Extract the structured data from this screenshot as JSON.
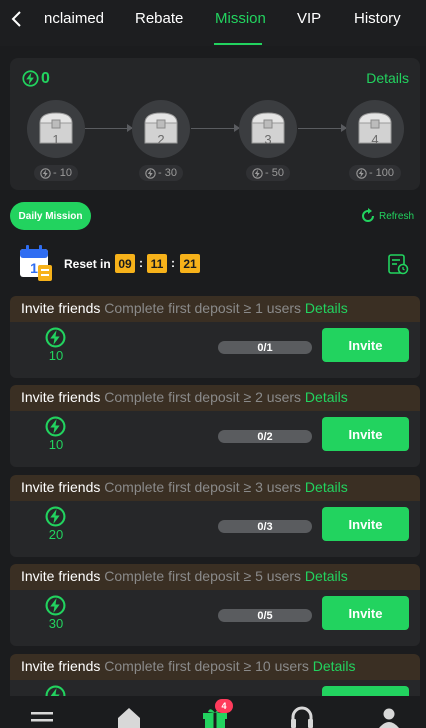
{
  "tabs": {
    "items": [
      {
        "label": "nclaimed"
      },
      {
        "label": "Rebate"
      },
      {
        "label": "Mission"
      },
      {
        "label": "VIP"
      },
      {
        "label": "History"
      }
    ],
    "active": "Mission"
  },
  "progress": {
    "count": "0",
    "details_label": "Details",
    "chests": [
      {
        "number": "1",
        "requirement": "- 10"
      },
      {
        "number": "2",
        "requirement": "- 30"
      },
      {
        "number": "3",
        "requirement": "- 50"
      },
      {
        "number": "4",
        "requirement": "- 100"
      }
    ]
  },
  "daily": {
    "label": "Daily Mission",
    "refresh_label": "Refresh",
    "reset_label": "Reset in",
    "time": {
      "h": "09",
      "m": "11",
      "s": "21"
    }
  },
  "missions": [
    {
      "title": "Invite friends",
      "condition": "Complete first deposit ≥ 1 users",
      "details": "Details",
      "reward": "10",
      "progress": "0/1",
      "button": "Invite"
    },
    {
      "title": "Invite friends",
      "condition": "Complete first deposit ≥ 2 users",
      "details": "Details",
      "reward": "10",
      "progress": "0/2",
      "button": "Invite"
    },
    {
      "title": "Invite friends",
      "condition": "Complete first deposit ≥ 3 users",
      "details": "Details",
      "reward": "20",
      "progress": "0/3",
      "button": "Invite"
    },
    {
      "title": "Invite friends",
      "condition": "Complete first deposit ≥ 5 users",
      "details": "Details",
      "reward": "30",
      "progress": "0/5",
      "button": "Invite"
    },
    {
      "title": "Invite friends",
      "condition": "Complete first deposit ≥ 10 users",
      "details": "Details",
      "reward": "",
      "progress": "",
      "button": ""
    }
  ],
  "nav": {
    "gift_badge": "4",
    "icons": [
      "menu-icon",
      "home-icon",
      "gift-icon",
      "headset-icon",
      "user-icon"
    ]
  },
  "colors": {
    "accent": "#22d35f",
    "timer": "#f7b21a",
    "badge": "#ff3b5c"
  }
}
